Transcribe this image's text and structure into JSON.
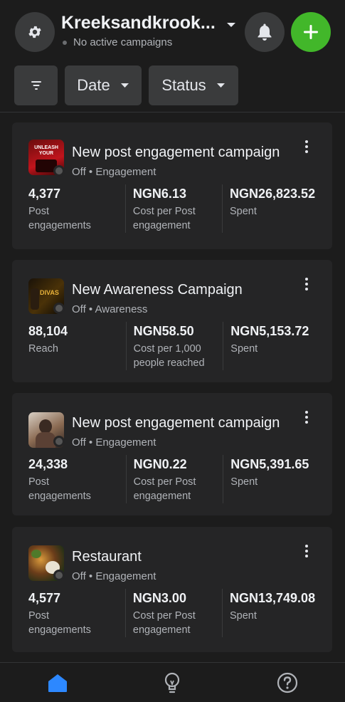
{
  "header": {
    "account_name": "Kreeksandkrook...",
    "status_text": "No active campaigns"
  },
  "filters": {
    "date_label": "Date",
    "status_label": "Status"
  },
  "campaigns": [
    {
      "title": "New post engagement campaign",
      "status": "Off",
      "objective": "Engagement",
      "metrics": [
        {
          "value": "4,377",
          "label": "Post engagements"
        },
        {
          "value": "NGN6.13",
          "label": "Cost per Post engagement"
        },
        {
          "value": "NGN26,823.52",
          "label": "Spent"
        }
      ]
    },
    {
      "title": "New Awareness Campaign",
      "status": "Off",
      "objective": "Awareness",
      "metrics": [
        {
          "value": "88,104",
          "label": "Reach"
        },
        {
          "value": "NGN58.50",
          "label": "Cost per 1,000 people reached"
        },
        {
          "value": "NGN5,153.72",
          "label": "Spent"
        }
      ]
    },
    {
      "title": "New post engagement campaign",
      "status": "Off",
      "objective": "Engagement",
      "metrics": [
        {
          "value": "24,338",
          "label": "Post engagements"
        },
        {
          "value": "NGN0.22",
          "label": "Cost per Post engagement"
        },
        {
          "value": "NGN5,391.65",
          "label": "Spent"
        }
      ]
    },
    {
      "title": "Restaurant",
      "status": "Off",
      "objective": "Engagement",
      "metrics": [
        {
          "value": "4,577",
          "label": "Post engagements"
        },
        {
          "value": "NGN3.00",
          "label": "Cost per Post engagement"
        },
        {
          "value": "NGN13,749.08",
          "label": "Spent"
        }
      ]
    }
  ],
  "thumbnail_texts": {
    "card1": "UNLEASH YOUR",
    "card2": "DIVAS"
  },
  "icons": {
    "settings": "gear-icon",
    "notifications": "bell-icon",
    "create": "plus-icon",
    "filter": "filter-icon",
    "home": "home-icon",
    "ideas": "lightbulb-icon",
    "help": "help-icon"
  },
  "colors": {
    "accent_green": "#42b72a",
    "active_blue": "#2d88ff",
    "background": "#1c1c1c",
    "card": "#252526"
  }
}
